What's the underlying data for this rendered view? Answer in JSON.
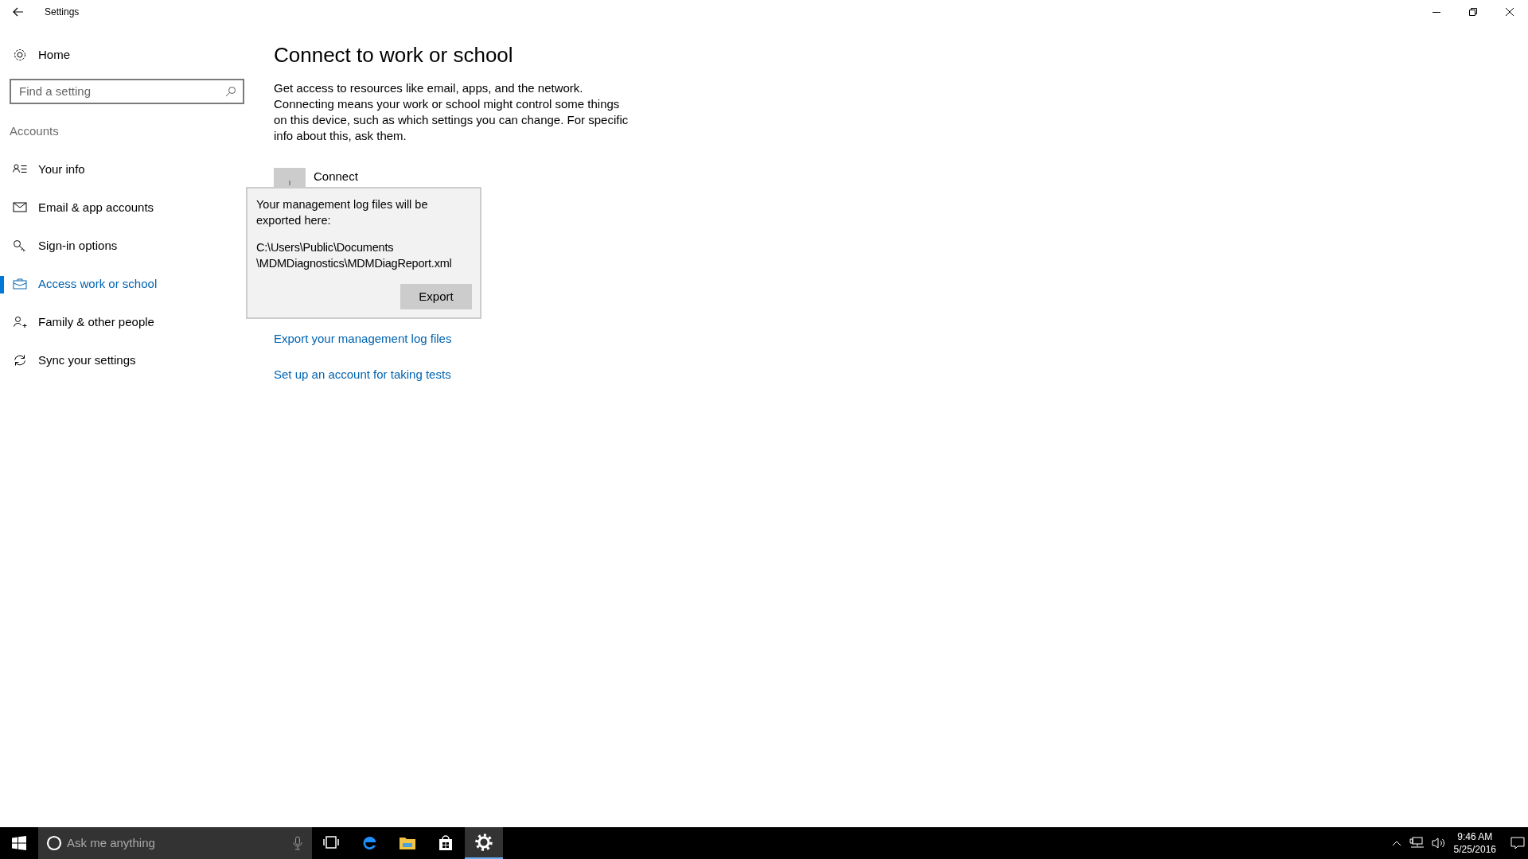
{
  "window": {
    "title": "Settings"
  },
  "sidebar": {
    "home": "Home",
    "search": {
      "placeholder": "Find a setting"
    },
    "section": "Accounts",
    "items": [
      {
        "label": "Your info",
        "selected": false
      },
      {
        "label": "Email & app accounts",
        "selected": false
      },
      {
        "label": "Sign-in options",
        "selected": false
      },
      {
        "label": "Access work or school",
        "selected": true
      },
      {
        "label": "Family & other people",
        "selected": false
      },
      {
        "label": "Sync your settings",
        "selected": false
      }
    ]
  },
  "content": {
    "heading": "Connect to work or school",
    "description": "Get access to resources like email, apps, and the network. Connecting means your work or school might control some things on this device, such as which settings you can change. For specific info about this, ask them.",
    "connect_button": "Connect",
    "links": [
      "Export your management log files",
      "Set up an account for taking tests"
    ]
  },
  "popup": {
    "message": "Your management log files will be exported here:",
    "path": [
      "C:\\Users\\Public\\Documents",
      "\\MDMDiagnostics\\MDMDiagReport.xml"
    ],
    "button": "Export"
  },
  "taskbar": {
    "search": {
      "placeholder": "Ask me anything"
    },
    "apps": [
      {
        "kind": "task-view",
        "selected": false
      },
      {
        "kind": "browser",
        "selected": false
      },
      {
        "kind": "folder",
        "selected": false
      },
      {
        "kind": "store",
        "selected": false
      },
      {
        "kind": "settings",
        "selected": true
      }
    ],
    "clock": {
      "time": "9:46 AM",
      "date": "5/25/2016"
    }
  }
}
